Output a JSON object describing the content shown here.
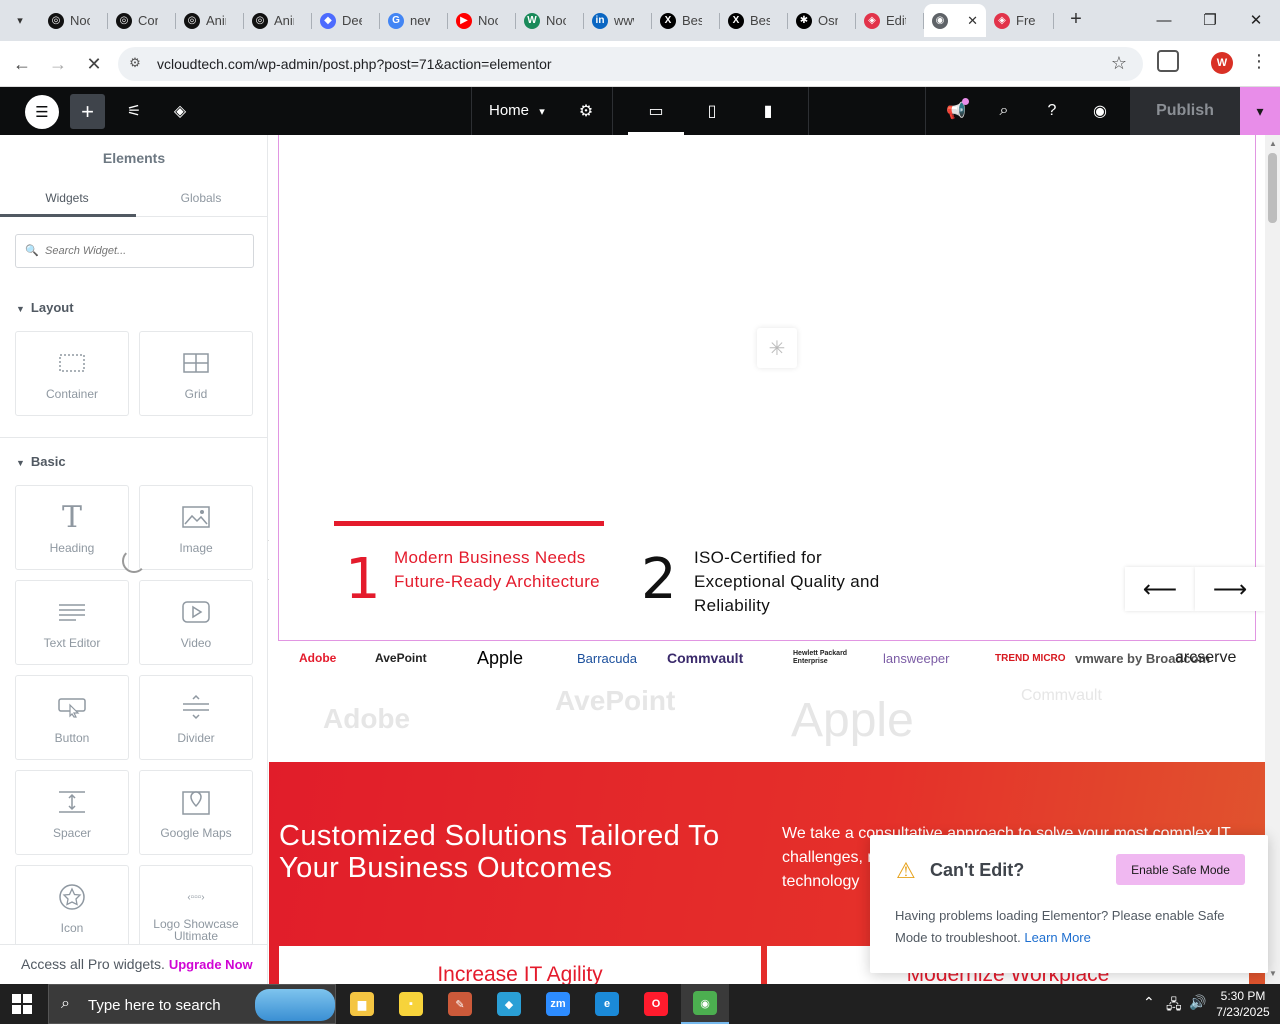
{
  "browser": {
    "tabs": [
      {
        "label": "Noo",
        "color": "#111111",
        "glyph": "◎"
      },
      {
        "label": "Con",
        "color": "#111111",
        "glyph": "◎"
      },
      {
        "label": "Anir",
        "color": "#111111",
        "glyph": "◎"
      },
      {
        "label": "Anir",
        "color": "#111111",
        "glyph": "◎"
      },
      {
        "label": "Dee",
        "color": "#4d6bfe",
        "glyph": "◆"
      },
      {
        "label": "new",
        "color": "#4285f4",
        "glyph": "G"
      },
      {
        "label": "Noo",
        "color": "#ff0000",
        "glyph": "▶"
      },
      {
        "label": "Noo",
        "color": "#1a8a5a",
        "glyph": "W"
      },
      {
        "label": "www",
        "color": "#0a66c2",
        "glyph": "in"
      },
      {
        "label": "Best",
        "color": "#000000",
        "glyph": "X"
      },
      {
        "label": "Best",
        "color": "#000000",
        "glyph": "X"
      },
      {
        "label": "Osn",
        "color": "#000000",
        "glyph": "✱"
      },
      {
        "label": "Edit",
        "color": "#e2334a",
        "glyph": "◈"
      },
      {
        "label": "",
        "color": "#5f6368",
        "glyph": "◉",
        "active": true
      },
      {
        "label": "Free",
        "color": "#e2334a",
        "glyph": "◈"
      }
    ],
    "url": "vcloudtech.com/wp-admin/post.php?post=71&action=elementor",
    "profile_initial": "W"
  },
  "editor": {
    "page_name": "Home",
    "publish_label": "Publish",
    "colors": {
      "accent": "#e88de9",
      "publish_bg": "#2b2d31"
    }
  },
  "panel": {
    "title": "Elements",
    "tabs": [
      "Widgets",
      "Globals"
    ],
    "search_placeholder": "Search Widget...",
    "sections": [
      {
        "title": "Layout",
        "widgets": [
          "Container",
          "Grid"
        ]
      },
      {
        "title": "Basic",
        "widgets": [
          "Heading",
          "Image",
          "Text Editor",
          "Video",
          "Button",
          "Divider",
          "Spacer",
          "Google Maps",
          "Icon",
          "Logo Showcase Ultimate"
        ]
      }
    ],
    "pro_text": "Access all Pro widgets.",
    "upgrade_label": "Upgrade Now"
  },
  "canvas": {
    "steps": [
      {
        "number": "1",
        "text": "Modern Business Needs Future-Ready Architecture",
        "color": "#e41b2c"
      },
      {
        "number": "2",
        "text": "ISO-Certified for Exceptional Quality and Reliability",
        "color": "#111111"
      }
    ],
    "logos": [
      "Adobe",
      "AvePoint",
      "Apple",
      "Barracuda",
      "Commvault",
      "Hewlett Packard Enterprise",
      "lansweeper",
      "TREND MICRO",
      "vmware by Broadcom",
      "arcserve"
    ],
    "faded_logos": [
      "Adobe",
      "AvePoint",
      "Apple",
      "Commvault"
    ],
    "red_title": "Customized Solutions Tailored To Your Business Outcomes",
    "red_desc": "We take a consultative approach to solve your most complex IT challenges, modernizing your infrastructure and enabling technology",
    "cards": [
      "Increase IT Agility",
      "Modernize Workplace"
    ]
  },
  "dialog": {
    "title": "Can't Edit?",
    "button": "Enable Safe Mode",
    "message": "Having problems loading Elementor? Please enable Safe Mode to troubleshoot.",
    "link": "Learn More"
  },
  "taskbar": {
    "search_placeholder": "Type here to search",
    "time": "5:30 PM",
    "date": "7/23/2025",
    "apps": [
      {
        "name": "file-explorer",
        "color": "#f4c542",
        "glyph": "▆"
      },
      {
        "name": "sticky-notes",
        "color": "#f7d33b",
        "glyph": "▪"
      },
      {
        "name": "paint",
        "color": "#cc5a3a",
        "glyph": "✎"
      },
      {
        "name": "app-diamond",
        "color": "#2a9fd6",
        "glyph": "◆"
      },
      {
        "name": "zoom",
        "color": "#2d8cff",
        "glyph": "zm"
      },
      {
        "name": "edge",
        "color": "#1b8ad8",
        "glyph": "e"
      },
      {
        "name": "opera",
        "color": "#ff1b2d",
        "glyph": "O"
      },
      {
        "name": "chrome",
        "color": "#4caf50",
        "glyph": "◉",
        "active": true
      }
    ]
  }
}
